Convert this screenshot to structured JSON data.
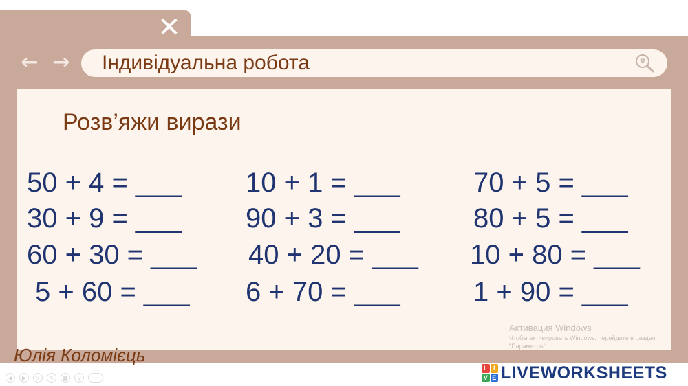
{
  "window": {
    "close_icon": "close-icon",
    "close_glyph": "✕",
    "back_glyph": "←",
    "forward_glyph": "→"
  },
  "address_bar": {
    "title": "Індивідуальна робота",
    "icon": "search-heart-icon"
  },
  "task": {
    "title": "Розв’яжи вирази"
  },
  "expressions": [
    [
      "50 + 4 = ___",
      "10 + 1 = ___",
      "70 + 5 = ___"
    ],
    [
      "30 + 9 = ___",
      "90 + 3 = ___",
      "80 + 5 = ___"
    ],
    [
      "60 + 30 = ___",
      "40 + 20 = ___",
      "10 + 80 = ___"
    ],
    [
      "5 + 60 = ___",
      "6 + 70 = ___",
      "1 + 90 = ___"
    ]
  ],
  "author": "Юлія Коломієць",
  "watermark": {
    "line1": "Активация Windows",
    "line2": "Чтобы активировать Windows, перейдите в раздел",
    "line3": "\"Параметры\"."
  },
  "brand": {
    "logo_letters": [
      "L",
      "I",
      "V",
      "E"
    ],
    "name": "LIVEWORKSHEETS",
    "color": "#1d3a7e"
  },
  "colors": {
    "frame": "#c9a99a",
    "panel": "#fdf5ed",
    "title_brown": "#7a3b14",
    "expression_blue": "#1f3470"
  }
}
